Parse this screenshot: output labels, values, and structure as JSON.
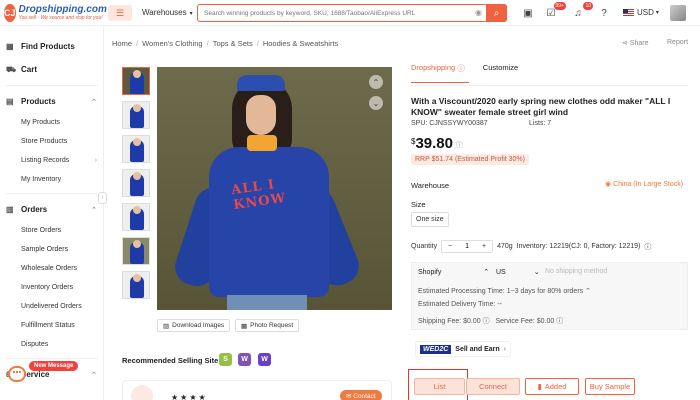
{
  "logo": {
    "mark": "CJ",
    "name": "Dropshipping.com",
    "tagline": "You sell · We source and ship for you!"
  },
  "header": {
    "warehouses_label": "Warehouses",
    "search_placeholder": "Search winning products by keyword, SKU, 1688/Taobao/AliExpress URL",
    "badge_cart": "99+",
    "badge_notify": "10",
    "currency": "USD"
  },
  "sidebar": {
    "find_products": "Find Products",
    "cart": "Cart",
    "products": "Products",
    "products_items": [
      "My Products",
      "Store Products",
      "Listing Records",
      "My Inventory"
    ],
    "orders": "Orders",
    "orders_items": [
      "Store Orders",
      "Sample Orders",
      "Wholesale Orders",
      "Inventory Orders",
      "Undelivered Orders",
      "Fulfillment Status",
      "Disputes"
    ],
    "service": "Service",
    "new_message": "New Message"
  },
  "breadcrumb": [
    "Home",
    "Women's Clothing",
    "Tops & Sets",
    "Hoodies & Sweatshirts"
  ],
  "share": "Share",
  "report": "Report",
  "gallery": {
    "print_text": "ALL I KNOW",
    "download": "Download Images",
    "photo_request": "Photo Request",
    "recommended": "Recommended Selling Site",
    "contact": "Contact"
  },
  "product": {
    "tab_dropshipping": "Dropshipping",
    "tab_customize": "Customize",
    "title": "With a Viscount/2020 early spring new clothes odd maker \"ALL I KNOW\" sweater female street girl wind",
    "spu": "SPU: CJNSSYWY00387",
    "lists": "Lists: 7",
    "currency_symbol": "$",
    "price": "39.80",
    "rrp": "RRP $51.74 (Estimated Profit 30%)",
    "warehouse_label": "Warehouse",
    "warehouse_value": "China (In Large Stock)",
    "size_label": "Size",
    "size_value": "One size",
    "quantity_label": "Quantity",
    "quantity": "1",
    "weight": "470g",
    "inventory": "Inventory: 12219(CJ: 0, Factory: 12219)"
  },
  "shipping": {
    "platform": "Shopify",
    "country": "US",
    "method_placeholder": "No shipping method",
    "processing": "Estimated Processing Time: 1~3 days for 80% orders",
    "delivery": "Estimated Delivery Time: --",
    "shipping_fee": "Shipping Fee: $0.00",
    "service_fee": "Service Fee: $0.00"
  },
  "d2c": {
    "badge": "WE",
    "badge2": "D2C",
    "text": "Sell and Earn"
  },
  "actions": {
    "list": "List",
    "connect": "Connect",
    "added": "Added",
    "buy_sample": "Buy Sample"
  },
  "colors": {
    "accent": "#f0613f",
    "brand_blue": "#2c5fb3"
  }
}
